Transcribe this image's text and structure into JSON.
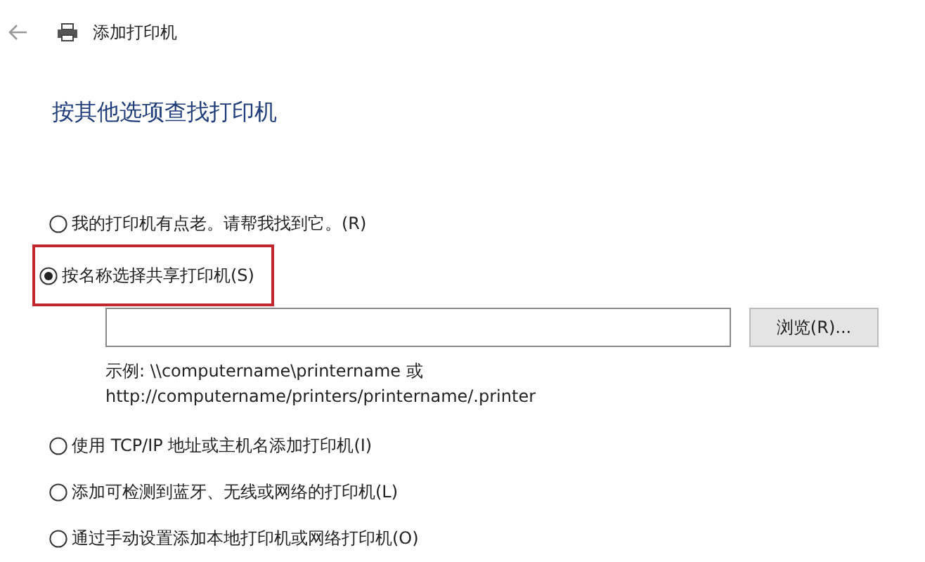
{
  "window": {
    "title": "添加打印机"
  },
  "heading": "按其他选项查找打印机",
  "options": [
    {
      "label": "我的打印机有点老。请帮我找到它。(R)",
      "selected": false,
      "highlighted": false
    },
    {
      "label": "按名称选择共享打印机(S)",
      "selected": true,
      "highlighted": true,
      "browse_button": "浏览(R)...",
      "example": [
        "示例: \\\\computername\\printername 或",
        "http://computername/printers/printername/.printer"
      ]
    },
    {
      "label": "使用 TCP/IP 地址或主机名添加打印机(I)",
      "selected": false,
      "highlighted": false
    },
    {
      "label": "添加可检测到蓝牙、无线或网络的打印机(L)",
      "selected": false,
      "highlighted": false
    },
    {
      "label": "通过手动设置添加本地打印机或网络打印机(O)",
      "selected": false,
      "highlighted": false
    }
  ]
}
